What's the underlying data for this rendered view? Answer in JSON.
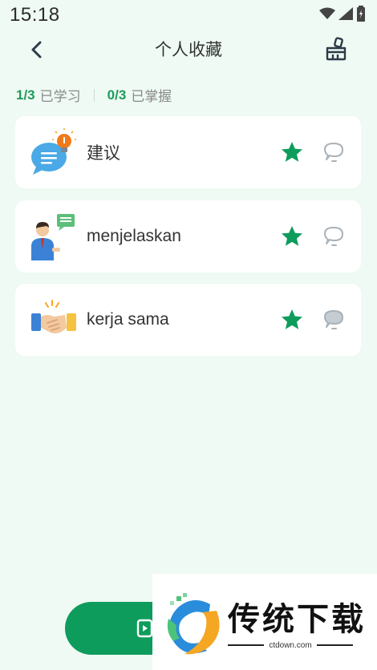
{
  "status_bar": {
    "time": "15:18",
    "icons": [
      "wifi-icon",
      "signal-icon",
      "battery-icon"
    ]
  },
  "header": {
    "title": "个人收藏",
    "back_icon": "chevron-left-icon",
    "clear_icon": "broom-icon"
  },
  "stats": {
    "learned_count": "1/3",
    "learned_label": "已学习",
    "mastered_count": "0/3",
    "mastered_label": "已掌握"
  },
  "items": [
    {
      "word": "建议",
      "icon": "speech-bubble-lightbulb-icon",
      "starred": true
    },
    {
      "word": "menjelaskan",
      "icon": "man-explaining-icon",
      "starred": true
    },
    {
      "word": "kerja sama",
      "icon": "handshake-icon",
      "starred": true
    }
  ],
  "watermark": {
    "title": "传统下载",
    "url": "ctdown.com"
  },
  "colors": {
    "accent": "#0e9c5c",
    "background": "#eefaf3",
    "card": "#ffffff",
    "star": "#0e9c5c"
  }
}
